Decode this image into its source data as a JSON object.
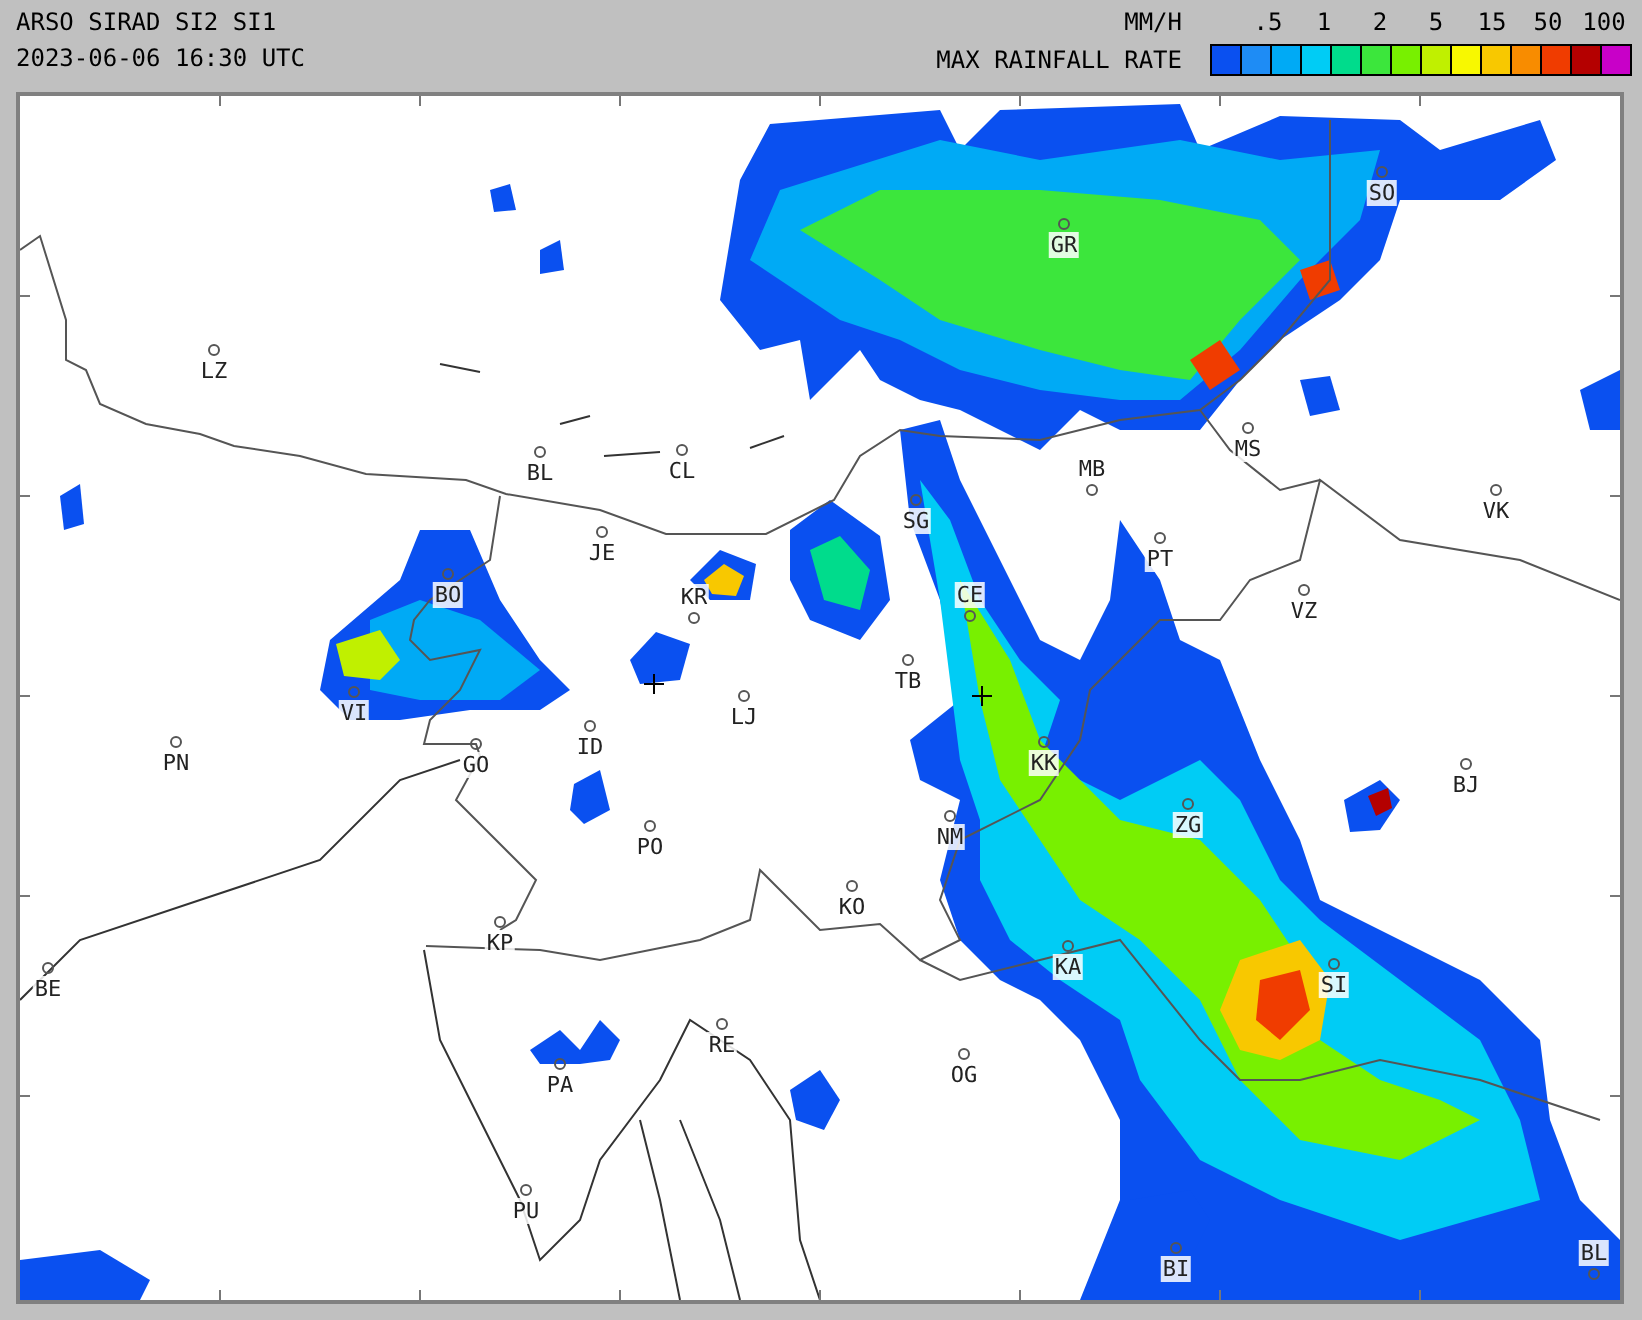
{
  "header": {
    "title": "ARSO SIRAD SI2 SI1",
    "timestamp": "2023-06-06 16:30 UTC"
  },
  "legend": {
    "unit": "MM/H",
    "caption": "MAX RAINFALL RATE",
    "ticks": [
      ".5",
      "1",
      "2",
      "5",
      "15",
      "50",
      "100"
    ],
    "swatches": [
      {
        "color": "#0a50f0"
      },
      {
        "color": "#1e8cf5"
      },
      {
        "color": "#00aaf5"
      },
      {
        "color": "#00ccf5"
      },
      {
        "color": "#00dc8c"
      },
      {
        "color": "#3ce63c"
      },
      {
        "color": "#78f000"
      },
      {
        "color": "#c0f000"
      },
      {
        "color": "#f8f800"
      },
      {
        "color": "#f8c800"
      },
      {
        "color": "#f88c00"
      },
      {
        "color": "#f03c00"
      },
      {
        "color": "#b40000"
      },
      {
        "color": "#c800c8"
      }
    ]
  },
  "map": {
    "places": [
      {
        "name": "LZ"
      },
      {
        "name": "BL"
      },
      {
        "name": "CL"
      },
      {
        "name": "JE"
      },
      {
        "name": "BO"
      },
      {
        "name": "KR"
      },
      {
        "name": "VI"
      },
      {
        "name": "LJ"
      },
      {
        "name": "PN"
      },
      {
        "name": "GO"
      },
      {
        "name": "ID"
      },
      {
        "name": "PO"
      },
      {
        "name": "GR"
      },
      {
        "name": "SO"
      },
      {
        "name": "MS"
      },
      {
        "name": "MB"
      },
      {
        "name": "SG"
      },
      {
        "name": "PT"
      },
      {
        "name": "VK"
      },
      {
        "name": "CE"
      },
      {
        "name": "VZ"
      },
      {
        "name": "TB"
      },
      {
        "name": "KK"
      },
      {
        "name": "BJ"
      },
      {
        "name": "NM"
      },
      {
        "name": "ZG"
      },
      {
        "name": "KO"
      },
      {
        "name": "KP"
      },
      {
        "name": "BE"
      },
      {
        "name": "KA"
      },
      {
        "name": "SI"
      },
      {
        "name": "RE"
      },
      {
        "name": "OG"
      },
      {
        "name": "PA"
      },
      {
        "name": "PU"
      },
      {
        "name": "BI"
      },
      {
        "name": "BL"
      }
    ]
  }
}
